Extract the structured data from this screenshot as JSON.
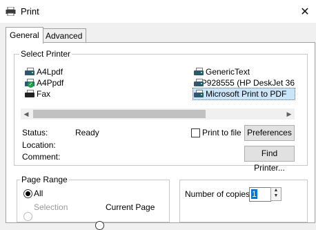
{
  "window": {
    "title": "Print",
    "close_glyph": "✕"
  },
  "tabs": [
    {
      "label": "General",
      "active": true
    },
    {
      "label": "Advanced",
      "active": false
    }
  ],
  "select_printer": {
    "group_label": "Select Printer",
    "printers": [
      {
        "name": "A4Lpdf",
        "icon": "printer-icon"
      },
      {
        "name": "A4Ppdf",
        "icon": "printer-default-icon"
      },
      {
        "name": "Fax",
        "icon": "fax-icon"
      },
      {
        "name": "GenericText",
        "icon": "printer-icon"
      },
      {
        "name": "HP928555 (HP DeskJet 36",
        "icon": "printer-icon"
      },
      {
        "name": "Microsoft Print to PDF",
        "icon": "printer-icon",
        "selected": true
      }
    ],
    "status_label": "Status:",
    "status_value": "Ready",
    "location_label": "Location:",
    "comment_label": "Comment:",
    "print_to_file_label": "Print to file",
    "preferences_button": "Preferences",
    "find_printer_button": "Find Printer..."
  },
  "page_range": {
    "group_label": "Page Range",
    "all_label": "All",
    "selection_label": "Selection",
    "current_page_label": "Current Page"
  },
  "copies": {
    "label": "Number of copies:",
    "value": "1"
  },
  "colors": {
    "selection": "#cce4f7",
    "accent": "#0078d7"
  }
}
